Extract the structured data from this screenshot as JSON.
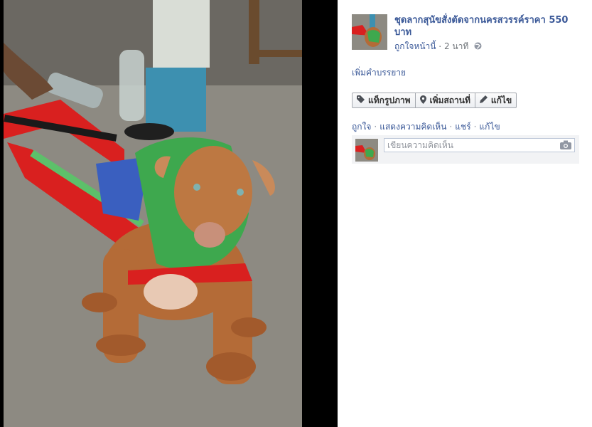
{
  "photo": {
    "alt_icon": "dog-in-harness-photo"
  },
  "post": {
    "title": "ชุดลากสุนัขสั่งตัดจากนครสวรรค์ราคา 550 บาท",
    "like_link": "ถูกใจหน้านี้",
    "dot": " · ",
    "time": "2 นาที",
    "add_description": "เพิ่มคำบรรยาย"
  },
  "toolbar": {
    "tag_label": "แท็กรูปภาพ",
    "location_label": "เพิ่มสถานที่",
    "edit_label": "แก้ไข"
  },
  "actions": {
    "like": "ถูกใจ",
    "comment": "แสดงความคิดเห็น",
    "share": "แชร์",
    "edit": "แก้ไข",
    "sep": "·"
  },
  "comment": {
    "placeholder": "เขียนความคิดเห็น"
  },
  "colors": {
    "link": "#3b5998",
    "side_bg": "#ffffff",
    "photo_bg": "#000000"
  }
}
